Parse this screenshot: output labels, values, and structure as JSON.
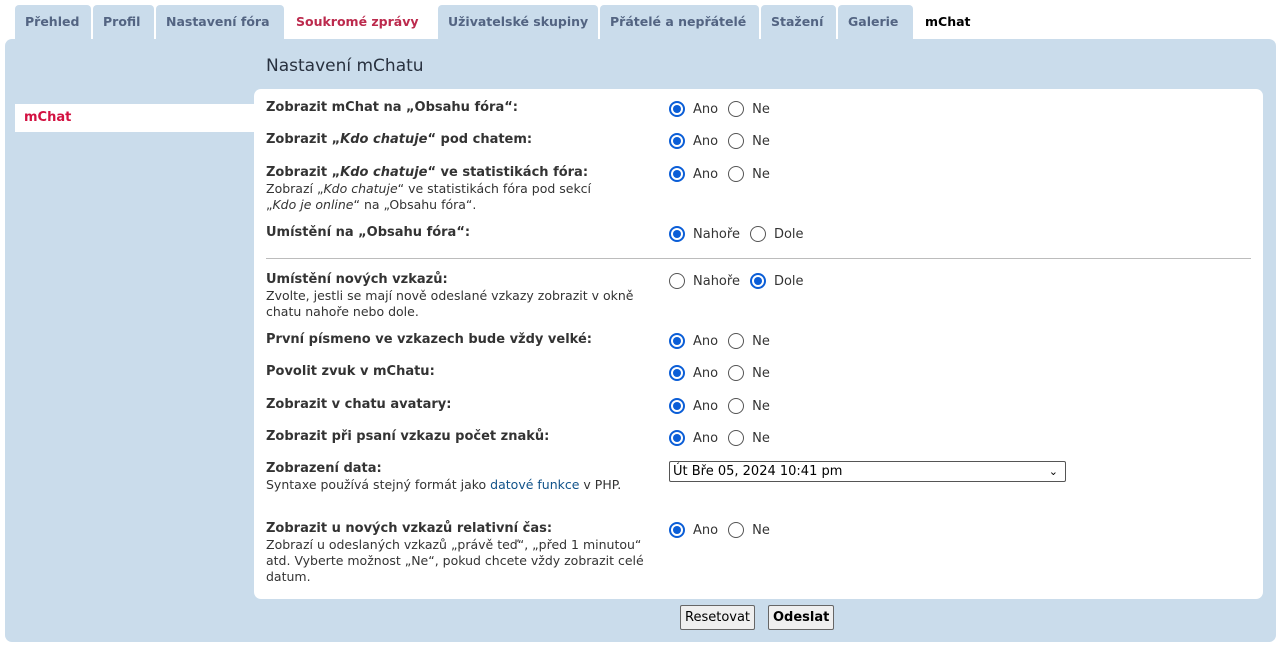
{
  "tabs": [
    {
      "label": "Přehled"
    },
    {
      "label": "Profil"
    },
    {
      "label": "Nastavení fóra"
    },
    {
      "label": "Soukromé zprávy"
    },
    {
      "label": "Uživatelské skupiny"
    },
    {
      "label": "Přátelé a nepřátelé"
    },
    {
      "label": "Stažení"
    },
    {
      "label": "Galerie"
    },
    {
      "label": "mChat"
    }
  ],
  "page_title": "Nastavení mChatu",
  "sidebar": {
    "items": [
      {
        "label": "mChat"
      }
    ]
  },
  "settings": {
    "r1": {
      "title": "Zobrazit mChat na „Obsahu fóra“:",
      "opt_a": "Ano",
      "opt_b": "Ne",
      "selected": "Ano"
    },
    "r2": {
      "title_pre": "Zobrazit „",
      "title_em": "Kdo chatuje",
      "title_post": "“ pod chatem:",
      "opt_a": "Ano",
      "opt_b": "Ne",
      "selected": "Ano"
    },
    "r3": {
      "title_pre": "Zobrazit „",
      "title_em": "Kdo chatuje",
      "title_post": "“ ve statistikách fóra:",
      "desc_1": "Zobrazí „",
      "desc_em1": "Kdo chatuje",
      "desc_2": "“ ve statistikách fóra pod sekcí",
      "desc_3": "„",
      "desc_em2": "Kdo je online",
      "desc_4": "“ na „Obsahu fóra“.",
      "opt_a": "Ano",
      "opt_b": "Ne",
      "selected": "Ano"
    },
    "r4": {
      "title": "Umístění na „Obsahu fóra“:",
      "opt_a": "Nahoře",
      "opt_b": "Dole",
      "selected": "Nahoře"
    },
    "r5": {
      "title": "Umístění nových vzkazů:",
      "desc": "Zvolte, jestli se mají nově odeslané vzkazy zobrazit v okně chatu nahoře nebo dole.",
      "opt_a": "Nahoře",
      "opt_b": "Dole",
      "selected": "Dole"
    },
    "r6": {
      "title": "První písmeno ve vzkazech bude vždy velké:",
      "opt_a": "Ano",
      "opt_b": "Ne",
      "selected": "Ano"
    },
    "r7": {
      "title": "Povolit zvuk v mChatu:",
      "opt_a": "Ano",
      "opt_b": "Ne",
      "selected": "Ano"
    },
    "r8": {
      "title": "Zobrazit v chatu avatary:",
      "opt_a": "Ano",
      "opt_b": "Ne",
      "selected": "Ano"
    },
    "r9": {
      "title": "Zobrazit při psaní vzkazu počet znaků:",
      "opt_a": "Ano",
      "opt_b": "Ne",
      "selected": "Ano"
    },
    "r10": {
      "title": "Zobrazení data:",
      "desc_pre": "Syntaxe používá stejný formát jako ",
      "desc_link": "datové funkce",
      "desc_post": " v PHP.",
      "value": "Út Bře 05, 2024 10:41 pm"
    },
    "r11": {
      "title": "Zobrazit u nových vzkazů relativní čas:",
      "desc": "Zobrazí u odeslaných vzkazů „právě teď“, „před 1 minutou“ atd. Vyberte možnost „Ne“, pokud chcete vždy zobrazit celé datum.",
      "opt_a": "Ano",
      "opt_b": "Ne",
      "selected": "Ano"
    }
  },
  "buttons": {
    "reset": "Resetovat",
    "submit": "Odeslat"
  }
}
